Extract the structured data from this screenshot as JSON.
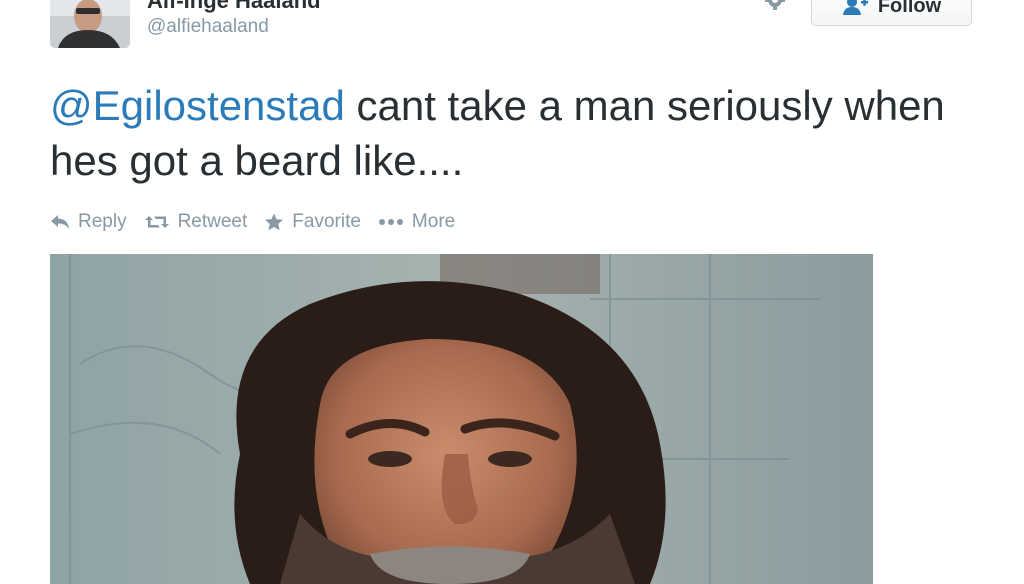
{
  "user": {
    "display_name": "Alf-Inge Haaland",
    "screen_name": "@alfiehaaland"
  },
  "follow_label": "Follow",
  "tweet": {
    "mention": "@Egilostenstad",
    "text": " cant take a man seriously when hes got a beard like...."
  },
  "actions": {
    "reply": "Reply",
    "retweet": "Retweet",
    "favorite": "Favorite",
    "more": "More"
  },
  "icons": [
    "gear-icon",
    "follow-person-icon",
    "reply-icon",
    "retweet-icon",
    "favorite-icon",
    "more-icon"
  ],
  "colors": {
    "link": "#2b7bb9",
    "text": "#292f33",
    "muted": "#8899a6"
  }
}
